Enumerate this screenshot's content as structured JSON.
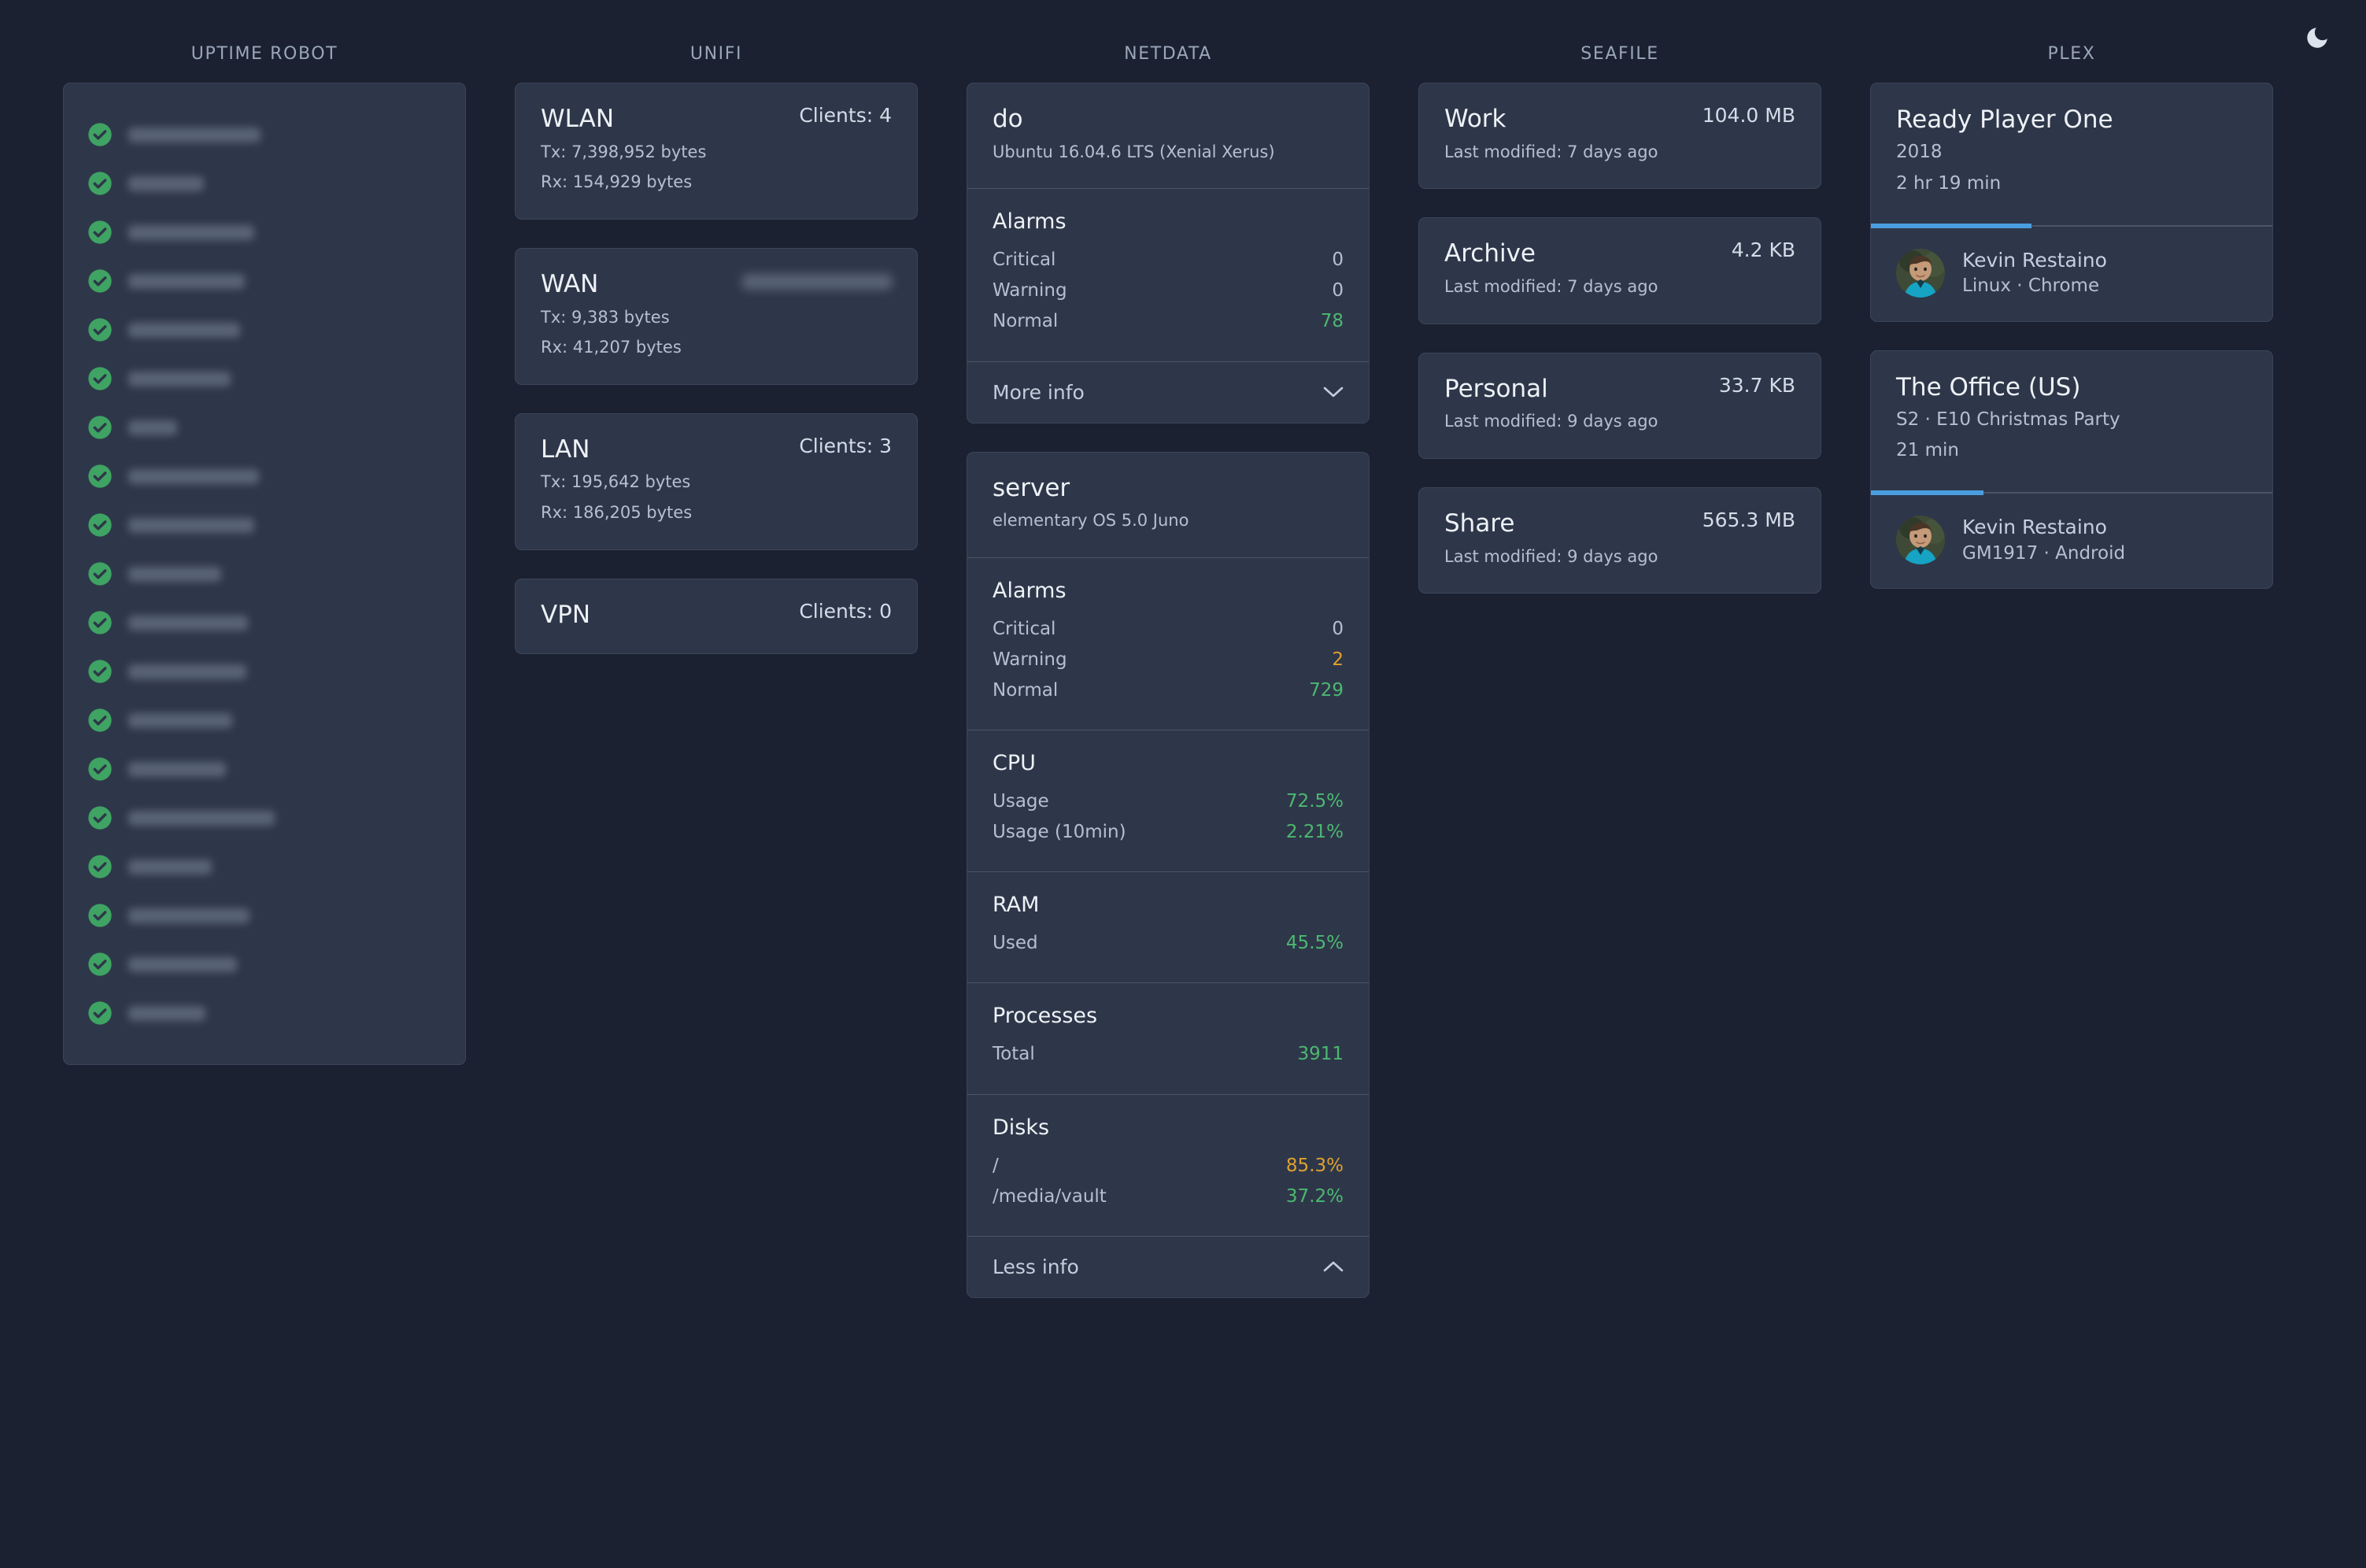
{
  "header": {
    "theme_toggle_icon": "moon-icon"
  },
  "columns": [
    {
      "key": "uptime_robot",
      "title": "UPTIME ROBOT",
      "type": "uptime",
      "items": [
        {
          "status_icon": "check-circle-icon",
          "status": "up",
          "name_redacted": true,
          "width": 168
        },
        {
          "status_icon": "check-circle-icon",
          "status": "up",
          "name_redacted": true,
          "width": 96
        },
        {
          "status_icon": "check-circle-icon",
          "status": "up",
          "name_redacted": true,
          "width": 160
        },
        {
          "status_icon": "check-circle-icon",
          "status": "up",
          "name_redacted": true,
          "width": 148
        },
        {
          "status_icon": "check-circle-icon",
          "status": "up",
          "name_redacted": true,
          "width": 142
        },
        {
          "status_icon": "check-circle-icon",
          "status": "up",
          "name_redacted": true,
          "width": 130
        },
        {
          "status_icon": "check-circle-icon",
          "status": "up",
          "name_redacted": true,
          "width": 62
        },
        {
          "status_icon": "check-circle-icon",
          "status": "up",
          "name_redacted": true,
          "width": 166
        },
        {
          "status_icon": "check-circle-icon",
          "status": "up",
          "name_redacted": true,
          "width": 160
        },
        {
          "status_icon": "check-circle-icon",
          "status": "up",
          "name_redacted": true,
          "width": 118
        },
        {
          "status_icon": "check-circle-icon",
          "status": "up",
          "name_redacted": true,
          "width": 152
        },
        {
          "status_icon": "check-circle-icon",
          "status": "up",
          "name_redacted": true,
          "width": 150
        },
        {
          "status_icon": "check-circle-icon",
          "status": "up",
          "name_redacted": true,
          "width": 132
        },
        {
          "status_icon": "check-circle-icon",
          "status": "up",
          "name_redacted": true,
          "width": 124
        },
        {
          "status_icon": "check-circle-icon",
          "status": "up",
          "name_redacted": true,
          "width": 186
        },
        {
          "status_icon": "check-circle-icon",
          "status": "up",
          "name_redacted": true,
          "width": 106
        },
        {
          "status_icon": "check-circle-icon",
          "status": "up",
          "name_redacted": true,
          "width": 154
        },
        {
          "status_icon": "check-circle-icon",
          "status": "up",
          "name_redacted": true,
          "width": 138
        },
        {
          "status_icon": "check-circle-icon",
          "status": "up",
          "name_redacted": true,
          "width": 98
        }
      ]
    },
    {
      "key": "unifi",
      "title": "UNIFI",
      "type": "unifi",
      "cards": [
        {
          "name": "WLAN",
          "right_label": "Clients: 4",
          "right_redacted": false,
          "tx": "Tx: 7,398,952 bytes",
          "rx": "Rx: 154,929 bytes"
        },
        {
          "name": "WAN",
          "right_label": "",
          "right_redacted": true,
          "tx": "Tx: 9,383 bytes",
          "rx": "Rx: 41,207 bytes"
        },
        {
          "name": "LAN",
          "right_label": "Clients: 3",
          "right_redacted": false,
          "tx": "Tx: 195,642 bytes",
          "rx": "Rx: 186,205 bytes"
        },
        {
          "name": "VPN",
          "right_label": "Clients: 0",
          "right_redacted": false,
          "tx": "",
          "rx": ""
        }
      ]
    },
    {
      "key": "netdata",
      "title": "NETDATA",
      "type": "netdata",
      "cards": [
        {
          "host": "do",
          "os": "Ubuntu 16.04.6 LTS (Xenial Xerus)",
          "sections": [
            {
              "heading": "Alarms",
              "rows": [
                {
                  "label": "Critical",
                  "value": "0",
                  "tone": "default"
                },
                {
                  "label": "Warning",
                  "value": "0",
                  "tone": "default"
                },
                {
                  "label": "Normal",
                  "value": "78",
                  "tone": "green"
                }
              ]
            }
          ],
          "footer_label": "More info",
          "footer_icon": "chevron-down-icon",
          "expanded": false
        },
        {
          "host": "server",
          "os": "elementary OS 5.0 Juno",
          "sections": [
            {
              "heading": "Alarms",
              "rows": [
                {
                  "label": "Critical",
                  "value": "0",
                  "tone": "default"
                },
                {
                  "label": "Warning",
                  "value": "2",
                  "tone": "orange"
                },
                {
                  "label": "Normal",
                  "value": "729",
                  "tone": "green"
                }
              ]
            },
            {
              "heading": "CPU",
              "rows": [
                {
                  "label": "Usage",
                  "value": "72.5%",
                  "tone": "green"
                },
                {
                  "label": "Usage (10min)",
                  "value": "2.21%",
                  "tone": "green"
                }
              ]
            },
            {
              "heading": "RAM",
              "rows": [
                {
                  "label": "Used",
                  "value": "45.5%",
                  "tone": "green"
                }
              ]
            },
            {
              "heading": "Processes",
              "rows": [
                {
                  "label": "Total",
                  "value": "3911",
                  "tone": "green"
                }
              ]
            },
            {
              "heading": "Disks",
              "rows": [
                {
                  "label": "/",
                  "value": "85.3%",
                  "tone": "orange"
                },
                {
                  "label": "/media/vault",
                  "value": "37.2%",
                  "tone": "green"
                }
              ]
            }
          ],
          "footer_label": "Less info",
          "footer_icon": "chevron-up-icon",
          "expanded": true
        }
      ]
    },
    {
      "key": "seafile",
      "title": "SEAFILE",
      "type": "seafile",
      "cards": [
        {
          "name": "Work",
          "size": "104.0 MB",
          "modified": "Last modified: 7 days ago"
        },
        {
          "name": "Archive",
          "size": "4.2 KB",
          "modified": "Last modified: 7 days ago"
        },
        {
          "name": "Personal",
          "size": "33.7 KB",
          "modified": "Last modified: 9 days ago"
        },
        {
          "name": "Share",
          "size": "565.3 MB",
          "modified": "Last modified: 9 days ago"
        }
      ]
    },
    {
      "key": "plex",
      "title": "PLEX",
      "type": "plex",
      "cards": [
        {
          "title": "Ready Player One",
          "subtitle": "2018",
          "duration": "2 hr 19 min",
          "progress_percent": 40,
          "user": "Kevin Restaino",
          "device": "Linux · Chrome",
          "avatar_icon": "user-avatar"
        },
        {
          "title": "The Office (US)",
          "subtitle": "S2 · E10 Christmas Party",
          "duration": "21 min",
          "progress_percent": 28,
          "user": "Kevin Restaino",
          "device": "GM1917 · Android",
          "avatar_icon": "user-avatar"
        }
      ]
    }
  ],
  "colors": {
    "page_background": "#1b2130",
    "card_background": "#2e3749",
    "card_border": "#3b455a",
    "divider": "#4a5568",
    "text_primary": "#eef2f7",
    "text_secondary": "#b4c0d1",
    "column_title": "#9aa6ba",
    "status_up_green": "#3fa363",
    "value_green": "#4cb870",
    "value_orange": "#e0a030",
    "progress_blue": "#4a9ee0"
  }
}
